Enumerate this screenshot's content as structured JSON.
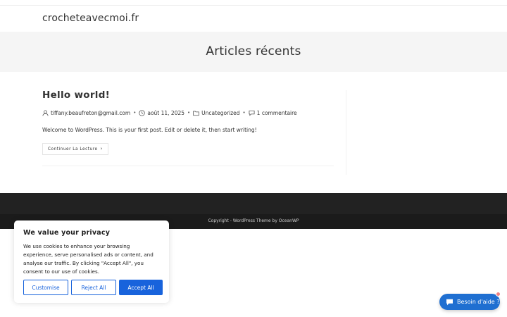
{
  "site": {
    "title": "crocheteavecmoi.fr"
  },
  "hero": {
    "title": "Articles récents"
  },
  "post": {
    "title": "Hello world!",
    "author": "tiffany.beaufreton@gmail.com",
    "date": "août 11, 2025",
    "category": "Uncategorized",
    "comments": "1 commentaire",
    "separator": "•",
    "excerpt": "Welcome to WordPress. This is your first post. Edit or delete it, then start writing!",
    "read_more": "Continuer La Lecture",
    "read_more_chevron": "›"
  },
  "footer": {
    "copyright": "Copyright - WordPress Theme by OceanWP"
  },
  "cookie": {
    "title": "We value your privacy",
    "text": "We use cookies to enhance your browsing experience, serve personalised ads or content, and analyse our traffic. By clicking \"Accept All\", you consent to our use of cookies.",
    "customise": "Customise",
    "reject": "Reject All",
    "accept": "Accept All",
    "accent_color": "#1863dc"
  },
  "chat": {
    "label": "Besoin d'aide ?",
    "color": "#1f6fd1"
  },
  "icons": {
    "author": "user-icon",
    "date": "clock-icon",
    "category": "folder-icon",
    "comments": "comment-icon",
    "chat": "chat-bubble-icon"
  }
}
